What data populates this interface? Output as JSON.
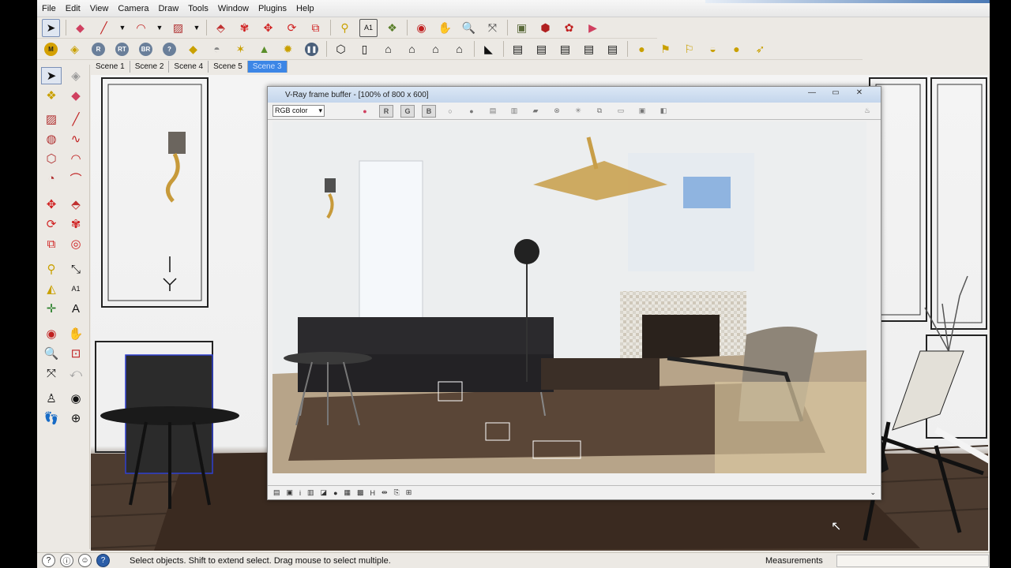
{
  "menu": [
    "File",
    "Edit",
    "View",
    "Camera",
    "Draw",
    "Tools",
    "Window",
    "Plugins",
    "Help"
  ],
  "toolbar1": [
    "select-arrow-icon",
    "eraser-icon",
    "pencil-icon",
    "dropdown-arrow-icon",
    "arc-icon",
    "dropdown-arrow-icon",
    "rectangle-icon",
    "dropdown-arrow-icon",
    "push-pull-icon",
    "follow-me-icon",
    "move-icon",
    "rotate-icon",
    "scale-icon",
    "tape-measure-icon",
    "text-icon",
    "paint-bucket-icon",
    "orbit-icon",
    "pan-icon",
    "zoom-icon",
    "zoom-extents-icon",
    "components-icon",
    "model-info-icon",
    "materials-icon",
    "styles-icon"
  ],
  "toolbar2": {
    "render_buttons": [
      "M",
      "",
      "R",
      "RT",
      "BR",
      "?",
      ""
    ],
    "extra": [
      "views-icon",
      "house-icon",
      "front-icon",
      "back-icon",
      "left-icon",
      "right-icon",
      "top-icon",
      "iso-icon"
    ]
  },
  "scenes": {
    "tabs": [
      "Scene 1",
      "Scene 2",
      "Scene 4",
      "Scene 5",
      "Scene 3"
    ],
    "active": "Scene 3"
  },
  "vray": {
    "title": "V-Ray frame buffer - [100% of 800 x 600]",
    "channel": "RGB color",
    "channels": [
      "R",
      "G",
      "B"
    ],
    "winbtns": [
      "—",
      "▭",
      "✕"
    ]
  },
  "status": {
    "message": "Select objects. Shift to extend select. Drag mouse to select multiple.",
    "measurements_label": "Measurements",
    "measurements_value": ""
  },
  "colors": {
    "accent": "#3c86e6",
    "title_bar": "#c4d6ec",
    "floor": "#4a3a2e"
  }
}
